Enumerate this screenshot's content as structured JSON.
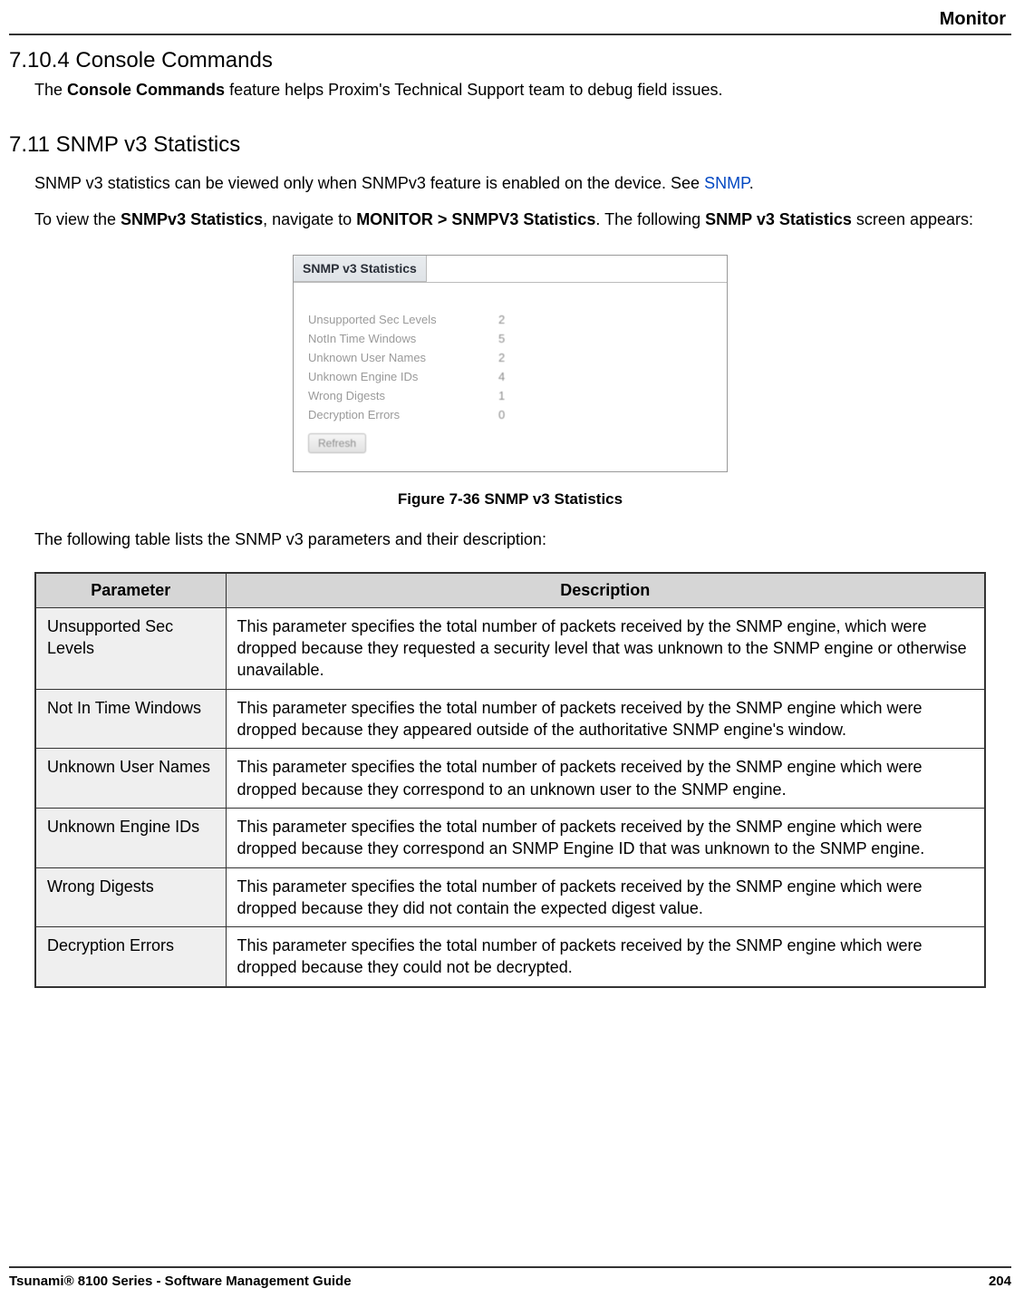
{
  "header": {
    "section": "Monitor"
  },
  "s1": {
    "heading": "7.10.4 Console Commands",
    "text_pre": "The ",
    "text_bold": "Console Commands",
    "text_post": " feature helps Proxim's Technical Support team to debug field issues."
  },
  "s2": {
    "heading": "7.11 SNMP v3 Statistics",
    "p1_pre": "SNMP v3 statistics can be viewed only when SNMPv3 feature is enabled on the device. See ",
    "p1_link": "SNMP",
    "p1_post": ".",
    "p2_a": "To view the ",
    "p2_b": "SNMPv3 Statistics",
    "p2_c": ", navigate to ",
    "p2_d": "MONITOR > SNMPV3 Statistics",
    "p2_e": ". The following ",
    "p2_f": "SNMP v3 Statistics",
    "p2_g": " screen appears:"
  },
  "figure": {
    "tab": "SNMP v3 Statistics",
    "rows": [
      {
        "label": "Unsupported Sec Levels",
        "value": "2"
      },
      {
        "label": "NotIn Time Windows",
        "value": "5"
      },
      {
        "label": "Unknown User Names",
        "value": "2"
      },
      {
        "label": "Unknown Engine IDs",
        "value": "4"
      },
      {
        "label": "Wrong Digests",
        "value": "1"
      },
      {
        "label": "Decryption Errors",
        "value": "0"
      }
    ],
    "button": "Refresh",
    "caption": "Figure 7-36 SNMP v3 Statistics"
  },
  "table_intro": "The following table lists the SNMP v3 parameters and their description:",
  "table": {
    "head_param": "Parameter",
    "head_desc": "Description",
    "rows": [
      {
        "param": "Unsupported Sec Levels",
        "desc": "This parameter specifies the total number of packets received by the SNMP engine, which were dropped because they requested a security level that was unknown to the SNMP engine or otherwise unavailable."
      },
      {
        "param": "Not In Time Windows",
        "desc": "This parameter specifies the total number of packets received by the SNMP engine which were dropped because they appeared outside of the authoritative SNMP engine's window."
      },
      {
        "param": "Unknown User Names",
        "desc": "This parameter specifies the total number of packets received by the SNMP engine which were dropped because they correspond to an unknown user to the SNMP engine."
      },
      {
        "param": "Unknown Engine IDs",
        "desc": "This parameter specifies the total number of packets received by the SNMP engine which were dropped because they correspond an SNMP Engine ID that was unknown to the SNMP engine."
      },
      {
        "param": "Wrong Digests",
        "desc": "This parameter specifies the total number of packets received by the SNMP engine which were dropped because they did not contain the expected digest value."
      },
      {
        "param": "Decryption Errors",
        "desc": "This parameter specifies the total number of packets received by the SNMP engine which were dropped because they could not be decrypted."
      }
    ]
  },
  "footer": {
    "left": "Tsunami® 8100 Series - Software Management Guide",
    "right": "204"
  }
}
